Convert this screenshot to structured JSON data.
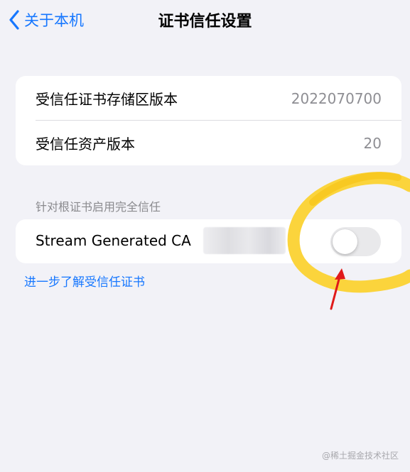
{
  "navbar": {
    "back_label": "关于本机",
    "title": "证书信任设置"
  },
  "versions": [
    {
      "label": "受信任证书存储区版本",
      "value": "2022070700"
    },
    {
      "label": "受信任资产版本",
      "value": "20"
    }
  ],
  "trust_section": {
    "header": "针对根证书启用完全信任",
    "certificate_name": "Stream Generated CA",
    "toggle_on": false
  },
  "learn_more": "进一步了解受信任证书",
  "watermark": "@稀土掘金技术社区",
  "colors": {
    "background": "#f2f2f7",
    "accent": "#1677ff",
    "annotation_yellow": "#fbd232",
    "annotation_arrow": "#e01a1a"
  }
}
